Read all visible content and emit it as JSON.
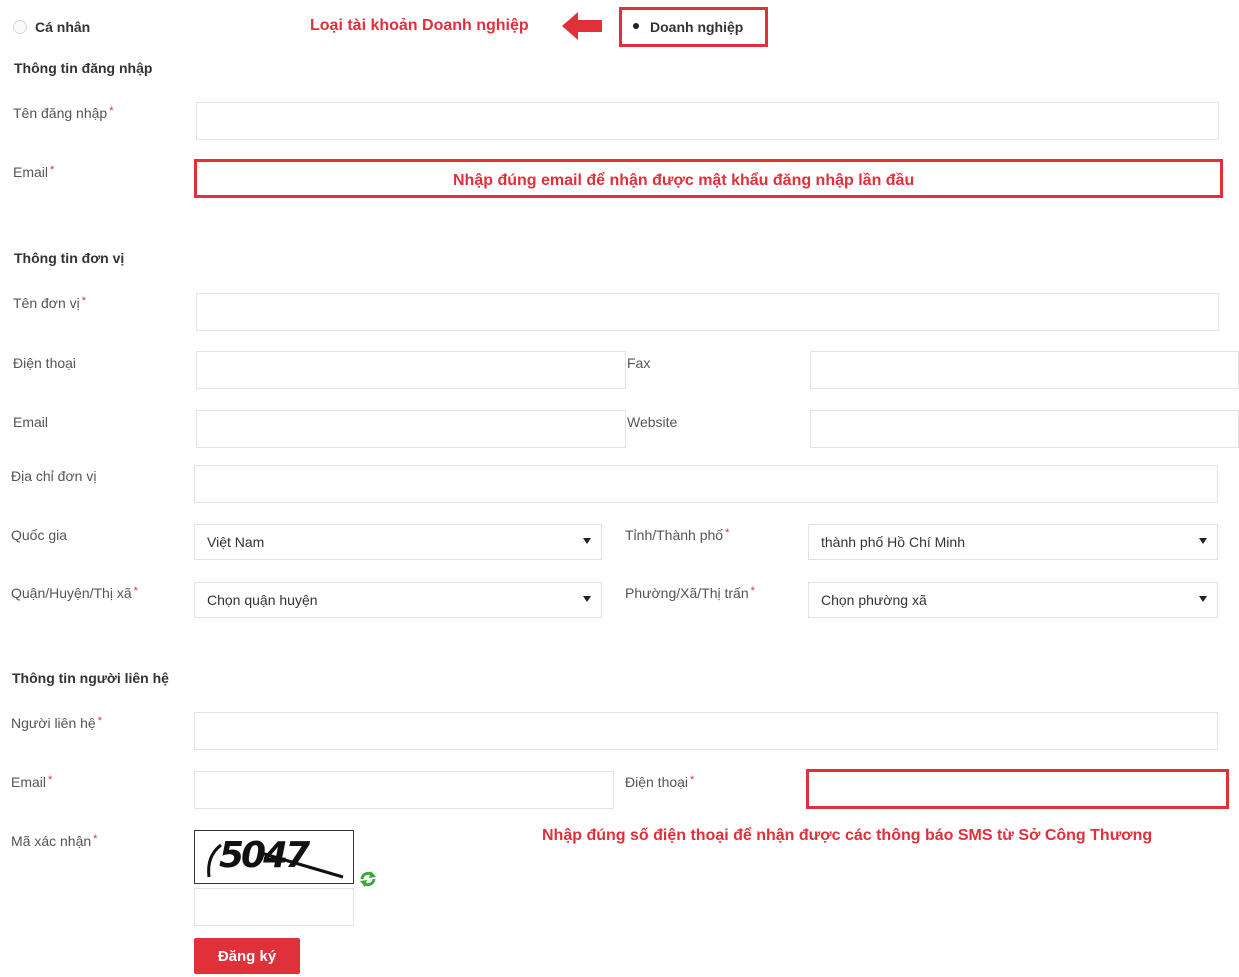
{
  "account_type": {
    "personal_label": "Cá nhân",
    "business_label": "Doanh nghiệp",
    "annotation": "Loại tài  khoản Doanh nghiệp"
  },
  "login_info": {
    "title": "Thông tin đăng nhập",
    "username_label": "Tên đăng nhập",
    "email_label": "Email",
    "email_annotation": "Nhập đúng email để nhận được mật khẩu đăng nhập lần đầu"
  },
  "unit_info": {
    "title": "Thông tin đơn vị",
    "name_label": "Tên đơn vị",
    "phone_label": "Điện thoại",
    "fax_label": "Fax",
    "email_label": "Email",
    "website_label": "Website",
    "address_label": "Địa chỉ đơn vị",
    "country_label": "Quốc gia",
    "country_value": "Việt Nam",
    "province_label": "Tỉnh/Thành phố",
    "province_value": "thành phố Hồ Chí Minh",
    "district_label": "Quận/Huyện/Thị xã",
    "district_value": "Chọn quận huyện",
    "ward_label": "Phường/Xã/Thị trấn",
    "ward_value": "Chọn phường xã"
  },
  "contact_info": {
    "title": "Thông tin người liên hệ",
    "contact_label": "Người liên hệ",
    "email_label": "Email",
    "phone_label": "Điện thoại",
    "phone_annotation": "Nhập đúng số điện thoại để nhận được các thông báo SMS từ Sở Công Thương",
    "captcha_label": "Mã xác nhận",
    "captcha_text": "5047"
  },
  "submit_label": "Đăng ký",
  "required_mark": "*",
  "colors": {
    "accent": "#e0303a",
    "captcha_refresh": "#3aa83a"
  }
}
